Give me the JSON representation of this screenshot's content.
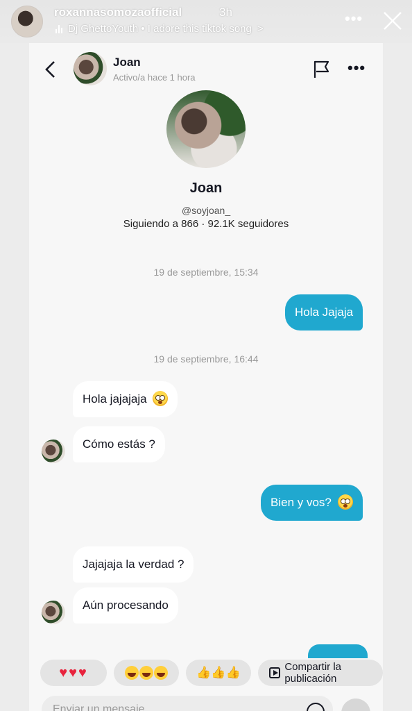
{
  "story": {
    "username": "roxannasomozaofficial",
    "time": "3h",
    "music": "Dj GhettoYouth • I adore this tiktok song",
    "chevron": ">",
    "more": "•••"
  },
  "chat": {
    "contact_name": "Joan",
    "status": "Activo/a hace 1 hora",
    "more": "•••",
    "profile": {
      "name": "Joan",
      "handle": "@soyjoan_",
      "stats": "Siguiendo a 866 · 92.1K seguidores"
    },
    "timestamps": [
      "19 de septiembre, 15:34",
      "19 de septiembre, 16:44"
    ],
    "messages": [
      {
        "side": "out",
        "text": "Hola Jajaja",
        "emoji": false
      },
      {
        "side": "in",
        "text": "Hola jajajaja",
        "emoji": true
      },
      {
        "side": "in",
        "text": "Cómo estás ?",
        "emoji": false
      },
      {
        "side": "out",
        "text": "Bien y vos?",
        "emoji": true
      },
      {
        "side": "in",
        "text": "Jajajaja la verdad ?",
        "emoji": false
      },
      {
        "side": "in",
        "text": "Aún procesando",
        "emoji": false
      }
    ]
  },
  "reactions": {
    "hearts": "♥♥♥",
    "thumbs": "👍👍👍",
    "share_label": "Compartir la publicación"
  },
  "input": {
    "placeholder": "Enviar un mensaje"
  },
  "colors": {
    "accent": "#20a8cf",
    "background": "#f7f7f7"
  }
}
